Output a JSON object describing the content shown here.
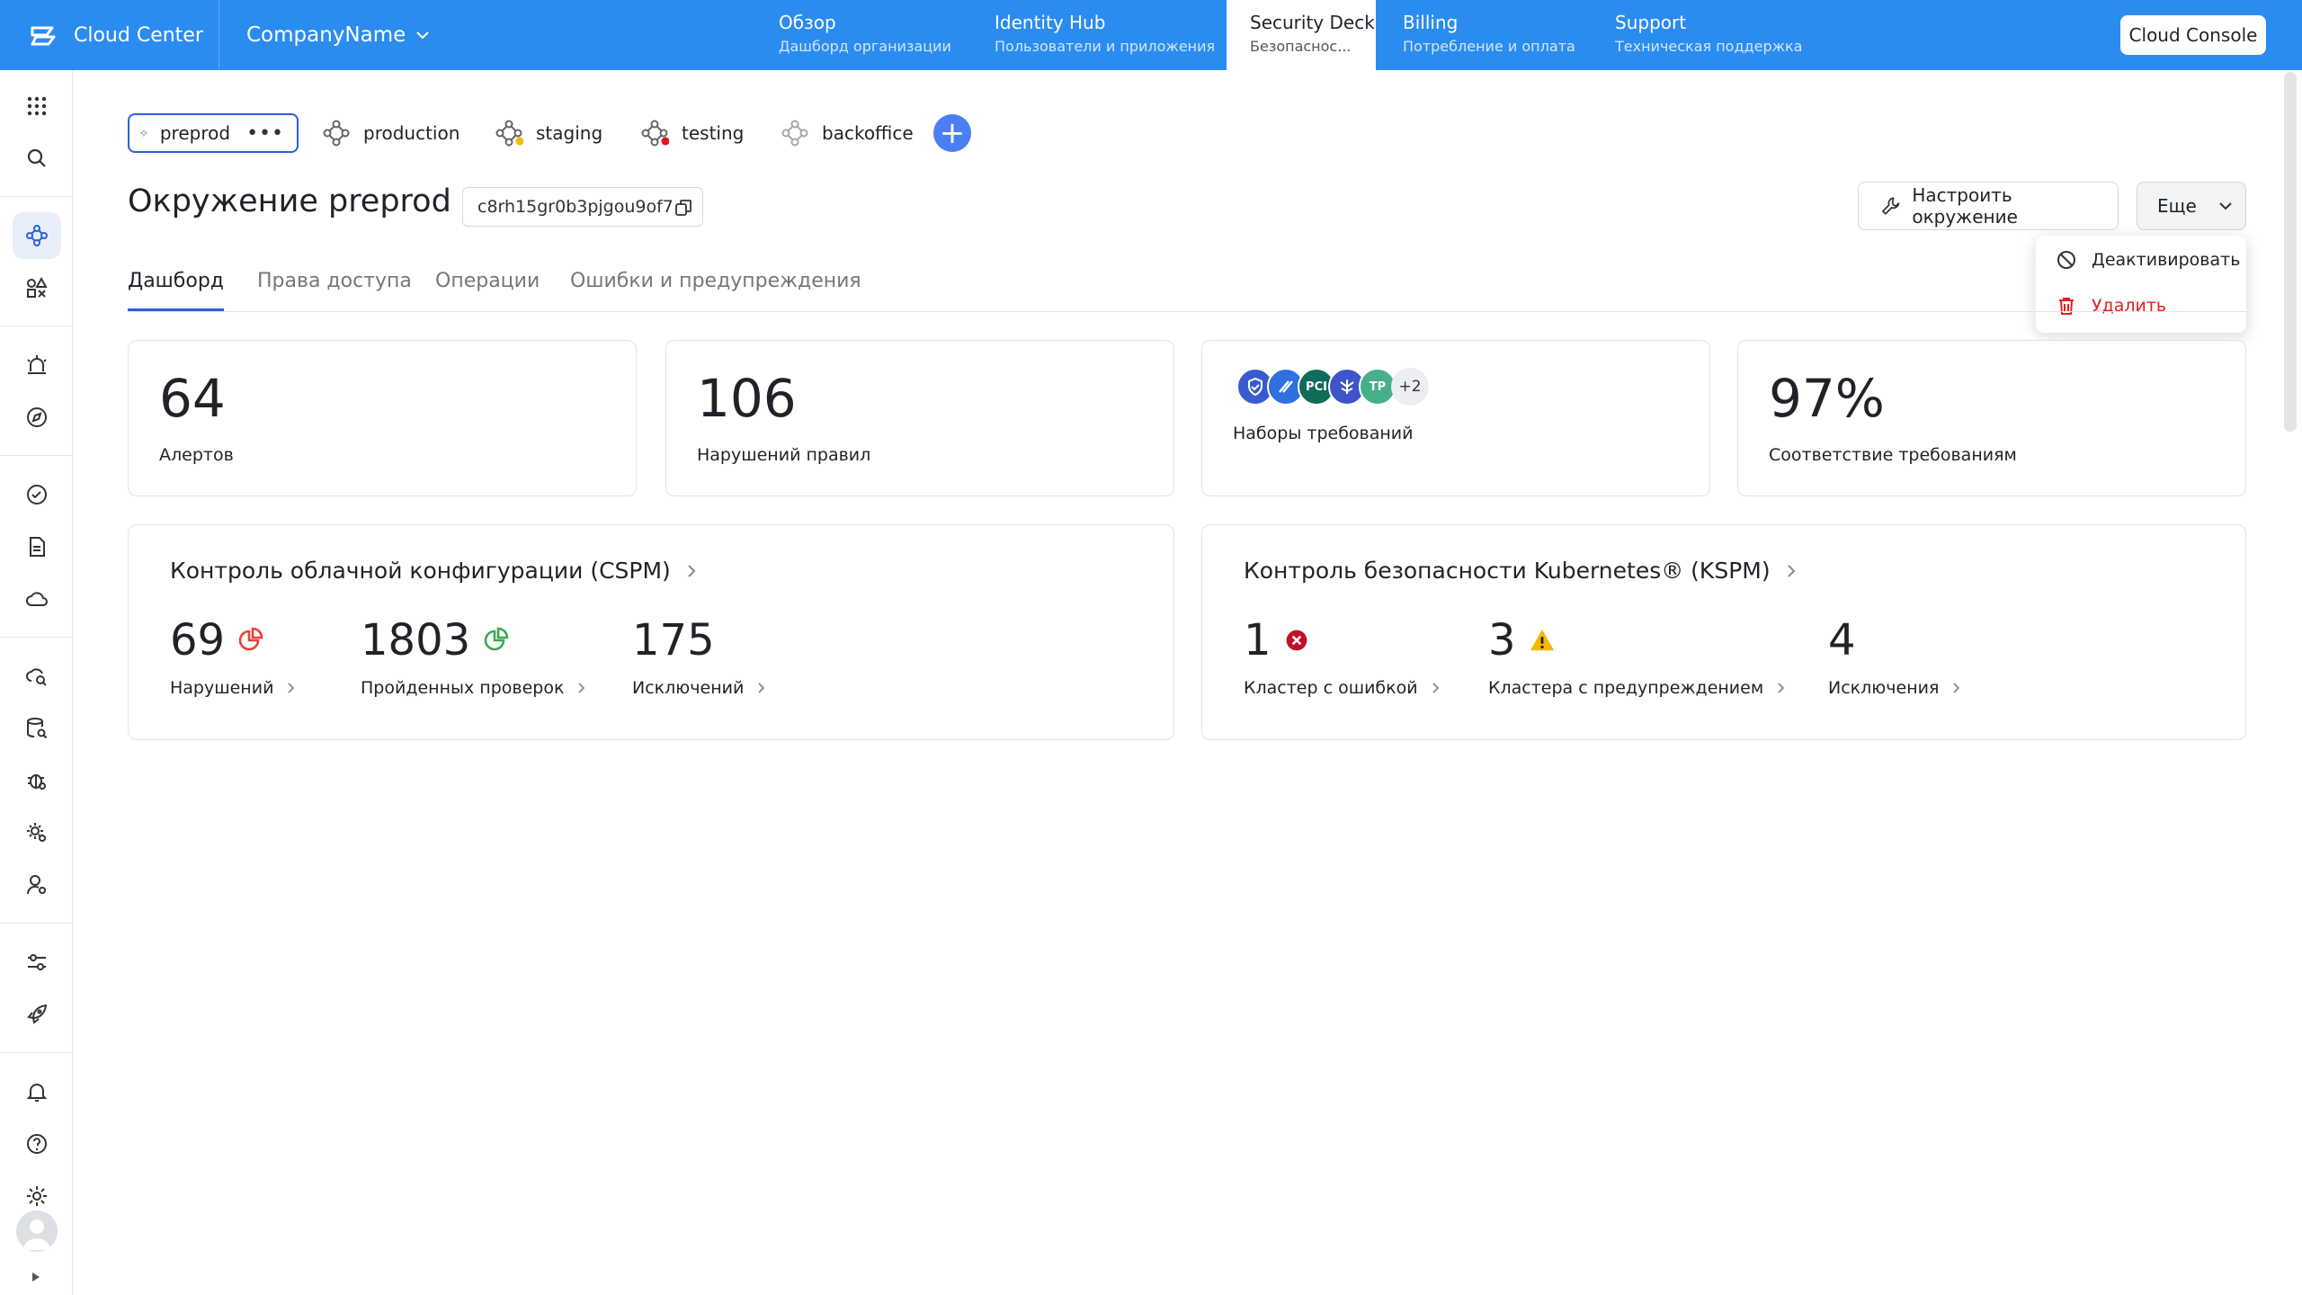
{
  "topbar": {
    "brand": "Cloud Center",
    "company": "CompanyName",
    "nav": [
      {
        "title": "Обзор",
        "subtitle": "Дашборд организации"
      },
      {
        "title": "Identity Hub",
        "subtitle": "Пользователи и приложения"
      },
      {
        "title": "Security Deck",
        "subtitle": "Безопаснос..."
      },
      {
        "title": "Billing",
        "subtitle": "Потребление и оплата"
      },
      {
        "title": "Support",
        "subtitle": "Техническая поддержка"
      }
    ],
    "console_button": "Cloud Console",
    "colors": {
      "bar": "#2b8cf0",
      "active_tab": "#ffffff"
    }
  },
  "environments": [
    {
      "name": "preprod",
      "selected": true,
      "status": "none"
    },
    {
      "name": "production",
      "status": "none"
    },
    {
      "name": "staging",
      "status": "warning"
    },
    {
      "name": "testing",
      "status": "error"
    },
    {
      "name": "backoffice",
      "status": "inactive"
    }
  ],
  "env_menu_glyph": "•••",
  "add_env_glyph": "+",
  "page": {
    "title": "Окружение preprod",
    "env_id": "c8rh15gr0b3pjgou9of7",
    "configure_button": "Настроить окружение",
    "more_button": "Еще"
  },
  "dropdown": {
    "items": [
      {
        "label": "Деактивировать",
        "icon": "block-icon"
      },
      {
        "label": "Удалить",
        "icon": "trash-icon",
        "danger": true
      }
    ]
  },
  "tabs": [
    "Дашборд",
    "Права доступа",
    "Операции",
    "Ошибки и предупреждения"
  ],
  "stats": {
    "alerts": {
      "value": "64",
      "label": "Алертов"
    },
    "violations": {
      "value": "106",
      "label": "Нарушений правил"
    },
    "standards": {
      "more": "+2",
      "label": "Наборы требований",
      "badges": [
        "shield-badge",
        "bank-badge",
        "pci-badge",
        "eagle-badge",
        "tp-badge"
      ],
      "badge_text_pci": "PCI",
      "badge_text_tp": "TP"
    },
    "compliance": {
      "value": "97%",
      "label": "Соответствие требованиям"
    }
  },
  "cspm": {
    "title": "Контроль облачной конфигурации (CSPM)",
    "metrics": [
      {
        "value": "69",
        "label": "Нарушений",
        "icon": "pie-red-icon"
      },
      {
        "value": "1803",
        "label": "Пройденных проверок",
        "icon": "pie-green-icon"
      },
      {
        "value": "175",
        "label": "Исключений"
      }
    ]
  },
  "kspm": {
    "title": "Контроль безопасности Kubernetes® (KSPM)",
    "metrics": [
      {
        "value": "1",
        "label": "Кластер с ошибкой",
        "icon": "error-circle-icon"
      },
      {
        "value": "3",
        "label": "Кластера с предупреждением",
        "icon": "warning-triangle-icon"
      },
      {
        "value": "4",
        "label": "Исключения"
      }
    ]
  },
  "status_colors": {
    "warning": "#f5b800",
    "error": "#e0141e",
    "danger": "#e02020",
    "accent": "#2b5fd9"
  }
}
